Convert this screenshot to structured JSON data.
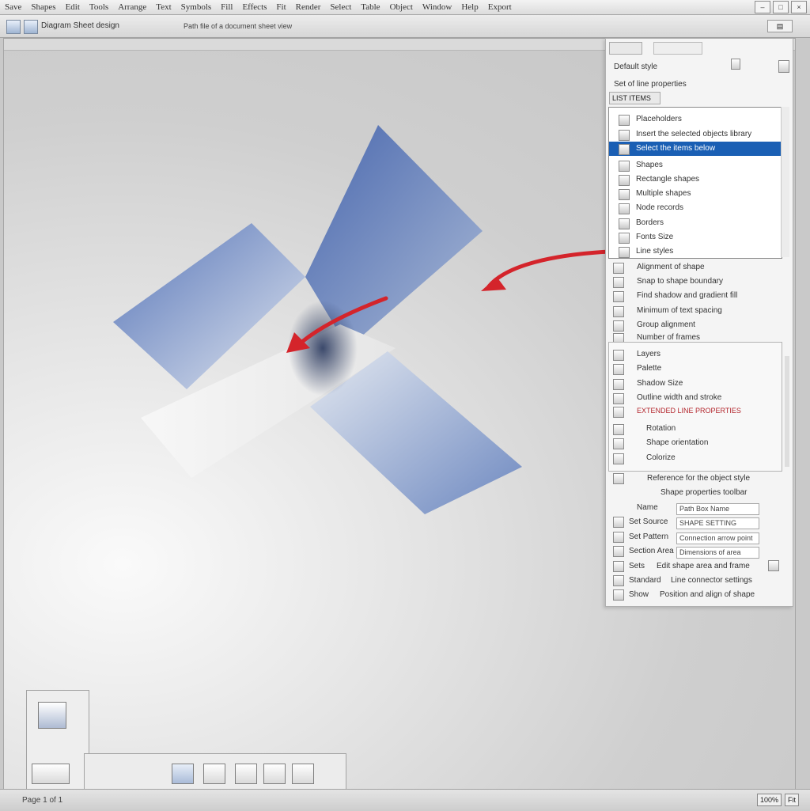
{
  "menu": {
    "items": [
      "Save",
      "Shapes",
      "Edit",
      "Tools",
      "Arrange",
      "Text",
      "Symbols",
      "Fill",
      "Effects",
      "Fit",
      "Render",
      "Select",
      "Table",
      "Object",
      "Window",
      "Help",
      "Export"
    ]
  },
  "toolbar2": {
    "doc_title": "Diagram Sheet design",
    "doc_path": "Path file of a document sheet view"
  },
  "panel": {
    "top_items": [
      "Default style",
      "Set of line properties"
    ],
    "sub_label": "LIST ITEMS",
    "dropdown": [
      {
        "label": "Placeholders",
        "selected": false
      },
      {
        "label": "Insert the selected objects library",
        "selected": false
      },
      {
        "label": "Select the items below",
        "selected": true
      },
      {
        "label": "Shapes",
        "selected": false
      },
      {
        "label": "Rectangle shapes",
        "selected": false
      },
      {
        "label": "Multiple shapes",
        "selected": false
      },
      {
        "label": "Node records",
        "selected": false
      },
      {
        "label": "Borders",
        "selected": false
      },
      {
        "label": "Fonts Size",
        "selected": false
      },
      {
        "label": "Line styles",
        "selected": false
      }
    ],
    "mid_items": [
      "Alignment of shape",
      "Snap to shape boundary",
      "Find shadow and gradient fill",
      "Minimum of text spacing",
      "Group alignment",
      "Number of frames"
    ],
    "box2_items": [
      {
        "label": "Layers",
        "accent": false
      },
      {
        "label": "Palette",
        "accent": false
      },
      {
        "label": "Shadow Size",
        "accent": false
      },
      {
        "label": "Outline width and stroke",
        "accent": false
      },
      {
        "label": "EXTENDED LINE PROPERTIES",
        "accent": true
      },
      {
        "label": "Rotation",
        "accent": false
      },
      {
        "label": "Shape orientation",
        "accent": false
      },
      {
        "label": "Colorize",
        "accent": false
      }
    ],
    "lower_items": [
      "Reference for the object style",
      "Shape properties toolbar"
    ],
    "fields": [
      {
        "label": "Name",
        "value": "Path Box Name"
      },
      {
        "label": "Set Source",
        "value": "SHAPE SETTING"
      },
      {
        "label": "Set Pattern",
        "value": "Connection arrow point"
      },
      {
        "label": "Section Area",
        "value": "Dimensions of area"
      },
      {
        "label": "Sets",
        "value": "Edit shape area and frame"
      },
      {
        "label": "Standard",
        "value": "Line connector settings"
      },
      {
        "label": "Show",
        "value": "Position and align of shape"
      }
    ]
  },
  "status": {
    "left": "Page 1 of 1",
    "right": [
      "100%",
      "Fit"
    ]
  },
  "colors": {
    "selection": "#1a5fb4",
    "arrow": "#d4242b",
    "shape_blue": "#4f6fb3"
  },
  "icons": [
    "menu-icon",
    "document-icon",
    "minimize-icon",
    "maximize-icon",
    "close-icon",
    "shape-icon",
    "layer-icon"
  ]
}
